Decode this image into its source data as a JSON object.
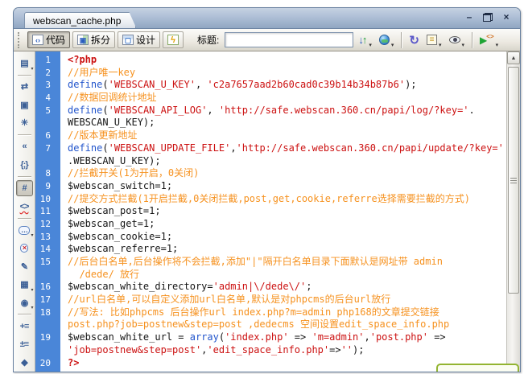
{
  "window": {
    "tab_label": "webscan_cache.php",
    "controls": {
      "minimize": "–",
      "close": "×"
    }
  },
  "toolbar": {
    "code_btn": "代码",
    "split_btn": "拆分",
    "design_btn": "设计",
    "title_label": "标题:",
    "title_value": "",
    "icons": {
      "code_view": "‹›",
      "split_view": "▣",
      "design_view": "▢",
      "live_view": "ϟ",
      "file_down": "↓",
      "file_up": "↑",
      "refresh": "↻",
      "view_list": "≡",
      "check_play": "▶",
      "check_code": "<>",
      "caret": "▾",
      "scroll_up": "▲"
    }
  },
  "side_toolbar": {
    "items": [
      {
        "name": "open-documents-icon",
        "glyph": "▤",
        "caret": true
      },
      {
        "name": "collapse-full-tag-icon",
        "glyph": "⇄",
        "sep": true
      },
      {
        "name": "collapse-selection-icon",
        "glyph": "▣"
      },
      {
        "name": "expand-all-icon",
        "glyph": "✳"
      },
      {
        "name": "select-parent-tag-icon",
        "glyph": "«",
        "sep": true
      },
      {
        "name": "balance-braces-icon",
        "glyph": "{;}"
      },
      {
        "name": "line-numbers-icon",
        "glyph": "#",
        "active": true,
        "sep": true
      },
      {
        "name": "highlight-invalid-code-icon",
        "glyph": "<>",
        "wavy": true
      },
      {
        "name": "apply-comment-icon",
        "glyph": "…",
        "bubble": true,
        "caret": true,
        "sep": true
      },
      {
        "name": "remove-comment-icon",
        "glyph": "×",
        "bubble": true,
        "red": true
      },
      {
        "name": "wrap-tag-icon",
        "glyph": "✎"
      },
      {
        "name": "recent-snippets-icon",
        "glyph": "▦",
        "caret": true
      },
      {
        "name": "move-css-icon",
        "glyph": "◉",
        "caret": true
      },
      {
        "name": "indent-code-icon",
        "glyph": "+≡",
        "sep": true
      },
      {
        "name": "outdent-code-icon",
        "glyph": "±≡"
      },
      {
        "name": "format-source-code-icon",
        "glyph": "◆"
      }
    ]
  },
  "code": {
    "rows": [
      {
        "n": "1",
        "s": [
          [
            "<?php",
            "tag"
          ]
        ]
      },
      {
        "n": "2",
        "s": [
          [
            "//用户唯一key",
            "com"
          ]
        ]
      },
      {
        "n": "3",
        "s": [
          [
            "define",
            "kw"
          ],
          [
            "(",
            "pl"
          ],
          [
            "'WEBSCAN_U_KEY'",
            "str"
          ],
          [
            ", ",
            "pl"
          ],
          [
            "'c2a7657aad2b60cad0c39b14b34b87b6'",
            "str"
          ],
          [
            ");",
            "pl"
          ]
        ]
      },
      {
        "n": "4",
        "s": [
          [
            "//数据回调统计地址",
            "com"
          ]
        ]
      },
      {
        "n": "5",
        "s": [
          [
            "define",
            "kw"
          ],
          [
            "(",
            "pl"
          ],
          [
            "'WEBSCAN_API_LOG'",
            "str"
          ],
          [
            ", ",
            "pl"
          ],
          [
            "'http://safe.webscan.360.cn/papi/log/?key='",
            "str"
          ],
          [
            ".",
            "pl"
          ]
        ]
      },
      {
        "n": "",
        "s": [
          [
            "WEBSCAN_U_KEY);",
            "pl"
          ]
        ]
      },
      {
        "n": "6",
        "s": [
          [
            "//版本更新地址",
            "com"
          ]
        ]
      },
      {
        "n": "7",
        "s": [
          [
            "define",
            "kw"
          ],
          [
            "(",
            "pl"
          ],
          [
            "'WEBSCAN_UPDATE_FILE'",
            "str"
          ],
          [
            ",",
            "pl"
          ],
          [
            "'http://safe.webscan.360.cn/papi/update/?key='",
            "str"
          ]
        ]
      },
      {
        "n": "",
        "s": [
          [
            ".WEBSCAN_U_KEY);",
            "pl"
          ]
        ]
      },
      {
        "n": "8",
        "s": [
          [
            "//拦截开关(1为开启，0关闭)",
            "com"
          ]
        ]
      },
      {
        "n": "9",
        "s": [
          [
            "$webscan_switch=1;",
            "pl"
          ]
        ]
      },
      {
        "n": "10",
        "s": [
          [
            "//提交方式拦截(1开启拦截,0关闭拦截,post,get,cookie,referre选择需要拦截的方式)",
            "com"
          ]
        ]
      },
      {
        "n": "11",
        "s": [
          [
            "$webscan_post=1;",
            "pl"
          ]
        ]
      },
      {
        "n": "12",
        "s": [
          [
            "$webscan_get=1;",
            "pl"
          ]
        ]
      },
      {
        "n": "13",
        "s": [
          [
            "$webscan_cookie=1;",
            "pl"
          ]
        ]
      },
      {
        "n": "14",
        "s": [
          [
            "$webscan_referre=1;",
            "pl"
          ]
        ]
      },
      {
        "n": "15",
        "s": [
          [
            "//后台白名单,后台操作将不会拦截,添加\"|\"隔开白名单目录下面默认是网址带 admin",
            "com"
          ]
        ]
      },
      {
        "n": "",
        "s": [
          [
            "  /dede/ 放行",
            "com"
          ]
        ]
      },
      {
        "n": "16",
        "s": [
          [
            "$webscan_white_directory=",
            "pl"
          ],
          [
            "'admin|\\/dede\\/'",
            "str"
          ],
          [
            ";",
            "pl"
          ]
        ]
      },
      {
        "n": "17",
        "s": [
          [
            "//url白名单,可以自定义添加url白名单,默认是对phpcms的后台url放行",
            "com"
          ]
        ]
      },
      {
        "n": "18",
        "s": [
          [
            "//写法: 比如phpcms 后台操作url index.php?m=admin php168的文章提交链接",
            "com"
          ]
        ]
      },
      {
        "n": "",
        "s": [
          [
            "post.php?job=postnew&step=post ,dedecms 空间设置edit_space_info.php",
            "com"
          ]
        ]
      },
      {
        "n": "19",
        "s": [
          [
            "$webscan_white_url = ",
            "pl"
          ],
          [
            "array",
            "kw"
          ],
          [
            "(",
            "pl"
          ],
          [
            "'index.php'",
            "str"
          ],
          [
            " => ",
            "pl"
          ],
          [
            "'m=admin'",
            "str"
          ],
          [
            ",",
            "pl"
          ],
          [
            "'post.php'",
            "str"
          ],
          [
            " =>",
            "pl"
          ]
        ]
      },
      {
        "n": "",
        "s": [
          [
            "'job=postnew&step=post'",
            "str"
          ],
          [
            ",",
            "pl"
          ],
          [
            "'edit_space_info.php'",
            "str"
          ],
          [
            "=>",
            "pl"
          ],
          [
            "''",
            "str"
          ],
          [
            ");",
            "pl"
          ]
        ]
      },
      {
        "n": "20",
        "s": [
          [
            "?>",
            "tag"
          ]
        ]
      }
    ]
  },
  "colors": {
    "gutter_blue": "#4a86d8",
    "comment_orange": "#f69220",
    "string_red": "#cc1111",
    "keyword_blue": "#2255cc",
    "plain_black": "#151515",
    "popup_green": "#93b431"
  }
}
